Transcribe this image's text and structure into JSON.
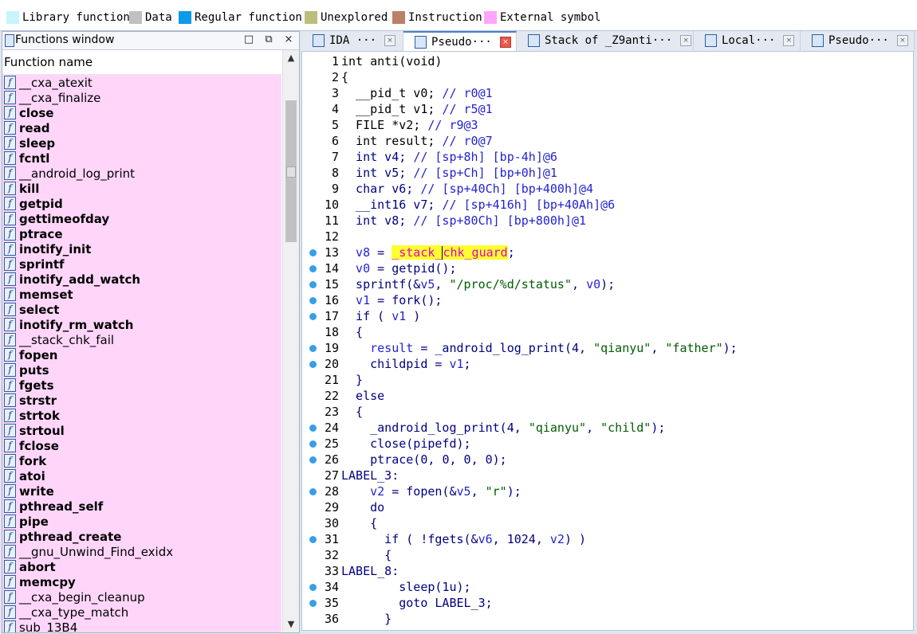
{
  "legend": [
    {
      "label": "Library function",
      "color": "#c6f5fa"
    },
    {
      "label": "Data",
      "color": "#c0c0c0"
    },
    {
      "label": "Regular function",
      "color": "#0c9be8"
    },
    {
      "label": "Unexplored",
      "color": "#bdbc7d"
    },
    {
      "label": "Instruction",
      "color": "#bb8067"
    },
    {
      "label": "External symbol",
      "color": "#ffa6fa"
    }
  ],
  "functions_window": {
    "title": "Functions window",
    "column_header": "Function name",
    "buttons": {
      "minimize": "□",
      "float": "⧉",
      "close": "×"
    },
    "items": [
      {
        "name": "__cxa_atexit",
        "bold": false
      },
      {
        "name": "__cxa_finalize",
        "bold": false
      },
      {
        "name": "close",
        "bold": true
      },
      {
        "name": "read",
        "bold": true
      },
      {
        "name": "sleep",
        "bold": true
      },
      {
        "name": "fcntl",
        "bold": true
      },
      {
        "name": "__android_log_print",
        "bold": false
      },
      {
        "name": "kill",
        "bold": true
      },
      {
        "name": "getpid",
        "bold": true
      },
      {
        "name": "gettimeofday",
        "bold": true
      },
      {
        "name": "ptrace",
        "bold": true
      },
      {
        "name": "inotify_init",
        "bold": true
      },
      {
        "name": "sprintf",
        "bold": true
      },
      {
        "name": "inotify_add_watch",
        "bold": true
      },
      {
        "name": "memset",
        "bold": true
      },
      {
        "name": "select",
        "bold": true
      },
      {
        "name": "inotify_rm_watch",
        "bold": true
      },
      {
        "name": "__stack_chk_fail",
        "bold": false
      },
      {
        "name": "fopen",
        "bold": true
      },
      {
        "name": "puts",
        "bold": true
      },
      {
        "name": "fgets",
        "bold": true
      },
      {
        "name": "strstr",
        "bold": true
      },
      {
        "name": "strtok",
        "bold": true
      },
      {
        "name": "strtoul",
        "bold": true
      },
      {
        "name": "fclose",
        "bold": true
      },
      {
        "name": "fork",
        "bold": true
      },
      {
        "name": "atoi",
        "bold": true
      },
      {
        "name": "write",
        "bold": true
      },
      {
        "name": "pthread_self",
        "bold": true
      },
      {
        "name": "pipe",
        "bold": true
      },
      {
        "name": "pthread_create",
        "bold": true
      },
      {
        "name": "__gnu_Unwind_Find_exidx",
        "bold": false
      },
      {
        "name": "abort",
        "bold": true
      },
      {
        "name": "memcpy",
        "bold": true
      },
      {
        "name": "__cxa_begin_cleanup",
        "bold": false
      },
      {
        "name": "__cxa_type_match",
        "bold": false
      },
      {
        "name": "sub_13B4",
        "bold": false
      }
    ]
  },
  "tabs": [
    {
      "label": "IDA ···",
      "active": false
    },
    {
      "label": "Pseudo···",
      "active": true
    },
    {
      "label": "Stack of _Z9anti···",
      "active": false
    },
    {
      "label": "Local···",
      "active": false
    },
    {
      "label": "Pseudo···",
      "active": false
    }
  ],
  "code_lines": [
    {
      "n": "1",
      "dot": false,
      "tokens": [
        [
          "t",
          "int anti(void)"
        ]
      ]
    },
    {
      "n": "2",
      "dot": false,
      "tokens": [
        [
          "t",
          "{"
        ]
      ]
    },
    {
      "n": "3",
      "dot": false,
      "tokens": [
        [
          "t",
          "  __pid_t v0; "
        ],
        [
          "c",
          "// r0@1"
        ]
      ]
    },
    {
      "n": "4",
      "dot": false,
      "tokens": [
        [
          "t",
          "  __pid_t v1; "
        ],
        [
          "c",
          "// r5@1"
        ]
      ]
    },
    {
      "n": "5",
      "dot": false,
      "tokens": [
        [
          "t",
          "  FILE *v2; "
        ],
        [
          "c",
          "// r9@3"
        ]
      ]
    },
    {
      "n": "6",
      "dot": false,
      "tokens": [
        [
          "t",
          "  int result; "
        ],
        [
          "c",
          "// r0@7"
        ]
      ]
    },
    {
      "n": "7",
      "dot": false,
      "tokens": [
        [
          "k",
          "  int v4; "
        ],
        [
          "c",
          "// [sp+8h] [bp-4h]@6"
        ]
      ]
    },
    {
      "n": "8",
      "dot": false,
      "tokens": [
        [
          "k",
          "  int v5; "
        ],
        [
          "c",
          "// [sp+Ch] [bp+0h]@1"
        ]
      ]
    },
    {
      "n": "9",
      "dot": false,
      "tokens": [
        [
          "k",
          "  char v6; "
        ],
        [
          "c",
          "// [sp+40Ch] [bp+400h]@4"
        ]
      ]
    },
    {
      "n": "10",
      "dot": false,
      "tokens": [
        [
          "k",
          "  __int16 v7; "
        ],
        [
          "c",
          "// [sp+416h] [bp+40Ah]@6"
        ]
      ]
    },
    {
      "n": "11",
      "dot": false,
      "tokens": [
        [
          "k",
          "  int v8; "
        ],
        [
          "c",
          "// [sp+80Ch] [bp+800h]@1"
        ]
      ]
    },
    {
      "n": "12",
      "dot": false,
      "tokens": [
        [
          "t",
          ""
        ]
      ]
    },
    {
      "n": "13",
      "dot": true,
      "tokens": [
        [
          "v",
          "  v8"
        ],
        [
          "k",
          " = "
        ],
        [
          "h",
          "_stack_"
        ],
        [
          "caret",
          ""
        ],
        [
          "h",
          "chk_guard"
        ],
        [
          "k",
          ";"
        ]
      ]
    },
    {
      "n": "14",
      "dot": true,
      "tokens": [
        [
          "v",
          "  v0"
        ],
        [
          "k",
          " = getpid();"
        ]
      ]
    },
    {
      "n": "15",
      "dot": true,
      "tokens": [
        [
          "k",
          "  sprintf(&"
        ],
        [
          "v",
          "v5"
        ],
        [
          "k",
          ", "
        ],
        [
          "s",
          "\"/proc/%d/status\""
        ],
        [
          "k",
          ", "
        ],
        [
          "v",
          "v0"
        ],
        [
          "k",
          ");"
        ]
      ]
    },
    {
      "n": "16",
      "dot": true,
      "tokens": [
        [
          "v",
          "  v1"
        ],
        [
          "k",
          " = fork();"
        ]
      ]
    },
    {
      "n": "17",
      "dot": true,
      "tokens": [
        [
          "k",
          "  if ( "
        ],
        [
          "v",
          "v1"
        ],
        [
          "k",
          " )"
        ]
      ]
    },
    {
      "n": "18",
      "dot": false,
      "tokens": [
        [
          "k",
          "  {"
        ]
      ]
    },
    {
      "n": "19",
      "dot": true,
      "tokens": [
        [
          "v",
          "    result"
        ],
        [
          "k",
          " = _android_log_print("
        ],
        [
          "n",
          "4"
        ],
        [
          "k",
          ", "
        ],
        [
          "s",
          "\"qianyu\""
        ],
        [
          "k",
          ", "
        ],
        [
          "s",
          "\"father\""
        ],
        [
          "k",
          ");"
        ]
      ]
    },
    {
      "n": "20",
      "dot": true,
      "tokens": [
        [
          "k",
          "    childpid = "
        ],
        [
          "v",
          "v1"
        ],
        [
          "k",
          ";"
        ]
      ]
    },
    {
      "n": "21",
      "dot": false,
      "tokens": [
        [
          "k",
          "  }"
        ]
      ]
    },
    {
      "n": "22",
      "dot": false,
      "tokens": [
        [
          "k",
          "  else"
        ]
      ]
    },
    {
      "n": "23",
      "dot": false,
      "tokens": [
        [
          "k",
          "  {"
        ]
      ]
    },
    {
      "n": "24",
      "dot": true,
      "tokens": [
        [
          "k",
          "    _android_log_print("
        ],
        [
          "n",
          "4"
        ],
        [
          "k",
          ", "
        ],
        [
          "s",
          "\"qianyu\""
        ],
        [
          "k",
          ", "
        ],
        [
          "s",
          "\"child\""
        ],
        [
          "k",
          ");"
        ]
      ]
    },
    {
      "n": "25",
      "dot": true,
      "tokens": [
        [
          "k",
          "    close(pipefd);"
        ]
      ]
    },
    {
      "n": "26",
      "dot": true,
      "tokens": [
        [
          "k",
          "    ptrace("
        ],
        [
          "n",
          "0"
        ],
        [
          "k",
          ", "
        ],
        [
          "n",
          "0"
        ],
        [
          "k",
          ", "
        ],
        [
          "n",
          "0"
        ],
        [
          "k",
          ", "
        ],
        [
          "n",
          "0"
        ],
        [
          "k",
          ");"
        ]
      ]
    },
    {
      "n": "27",
      "dot": false,
      "tokens": [
        [
          "k",
          "LABEL_3:"
        ]
      ]
    },
    {
      "n": "28",
      "dot": true,
      "tokens": [
        [
          "v",
          "    v2"
        ],
        [
          "k",
          " = fopen(&"
        ],
        [
          "v",
          "v5"
        ],
        [
          "k",
          ", "
        ],
        [
          "s",
          "\"r\""
        ],
        [
          "k",
          ");"
        ]
      ]
    },
    {
      "n": "29",
      "dot": false,
      "tokens": [
        [
          "k",
          "    do"
        ]
      ]
    },
    {
      "n": "30",
      "dot": false,
      "tokens": [
        [
          "k",
          "    {"
        ]
      ]
    },
    {
      "n": "31",
      "dot": true,
      "tokens": [
        [
          "k",
          "      if ( !fgets(&"
        ],
        [
          "v",
          "v6"
        ],
        [
          "k",
          ", "
        ],
        [
          "n",
          "1024"
        ],
        [
          "k",
          ", "
        ],
        [
          "v",
          "v2"
        ],
        [
          "k",
          ") )"
        ]
      ]
    },
    {
      "n": "32",
      "dot": false,
      "tokens": [
        [
          "k",
          "      {"
        ]
      ]
    },
    {
      "n": "33",
      "dot": false,
      "tokens": [
        [
          "k",
          "LABEL_8:"
        ]
      ]
    },
    {
      "n": "34",
      "dot": true,
      "tokens": [
        [
          "k",
          "        sleep("
        ],
        [
          "n",
          "1u"
        ],
        [
          "k",
          ");"
        ]
      ]
    },
    {
      "n": "35",
      "dot": true,
      "tokens": [
        [
          "k",
          "        goto LABEL_3;"
        ]
      ]
    },
    {
      "n": "36",
      "dot": false,
      "tokens": [
        [
          "k",
          "      }"
        ]
      ]
    }
  ]
}
